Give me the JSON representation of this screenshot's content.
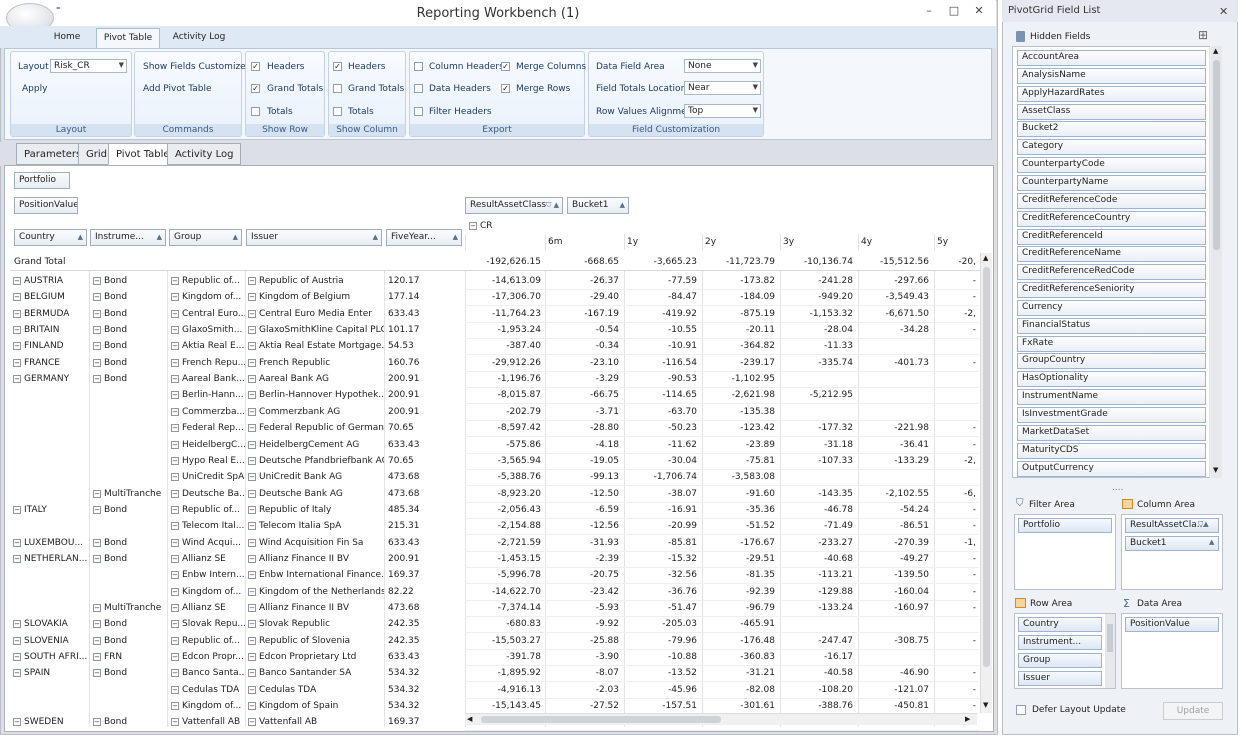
{
  "window": {
    "title": "Reporting Workbench (1)",
    "quick_access": "⁼",
    "min": "–",
    "max": "□",
    "close": "✕"
  },
  "ribbon_tabs": [
    "Home",
    "Pivot Table",
    "Activity Log"
  ],
  "ribbon": {
    "layout_group": {
      "layout_label": "Layout",
      "layout_value": "Risk_CR",
      "apply": "Apply",
      "caption": "Layout"
    },
    "commands_group": {
      "show_fields": "Show Fields Customizer",
      "add_pivot": "Add Pivot Table",
      "caption": "Commands"
    },
    "show_row": {
      "items": [
        {
          "label": "Headers",
          "checked": true
        },
        {
          "label": "Grand Totals",
          "checked": true
        },
        {
          "label": "Totals",
          "checked": false
        }
      ],
      "caption": "Show Row"
    },
    "show_column": {
      "items": [
        {
          "label": "Headers",
          "checked": true
        },
        {
          "label": "Grand Totals",
          "checked": false
        },
        {
          "label": "Totals",
          "checked": false
        }
      ],
      "caption": "Show Column"
    },
    "export": {
      "col1": [
        {
          "label": "Column Headers",
          "checked": false
        },
        {
          "label": "Data Headers",
          "checked": false
        },
        {
          "label": "Filter Headers",
          "checked": false
        }
      ],
      "col2": [
        {
          "label": "Merge Columns",
          "checked": true
        },
        {
          "label": "Merge Rows",
          "checked": true
        }
      ],
      "caption": "Export"
    },
    "field_custom": {
      "items": [
        {
          "label": "Data Field Area",
          "value": "None"
        },
        {
          "label": "Field Totals Location",
          "value": "Near"
        },
        {
          "label": "Row Values Alignment",
          "value": "Top"
        }
      ],
      "caption": "Field Customization"
    }
  },
  "doc_tabs": [
    "Parameters",
    "Grid",
    "Pivot Table",
    "Activity Log"
  ],
  "pivot": {
    "filter_field": "Portfolio",
    "data_field": "PositionValue",
    "col_fields": [
      "ResultAssetClass",
      "Bucket1"
    ],
    "row_fields": [
      "Country",
      "Instrume...",
      "Group",
      "Issuer",
      "FiveYear..."
    ],
    "cr_label": "CR",
    "col_buckets": [
      "",
      "6m",
      "1y",
      "2y",
      "3y",
      "4y",
      "5y"
    ],
    "grand_total_label": "Grand Total",
    "grand_total_values": [
      "-192,626.15",
      "-668.65",
      "-3,665.23",
      "-11,723.79",
      "-10,136.74",
      "-15,512.56",
      "-20,"
    ],
    "rows": [
      {
        "country": "AUSTRIA",
        "instr": "Bond",
        "group": "Republic of...",
        "issuer": "Republic of Austria",
        "five": "120.17",
        "v": [
          "-14,613.09",
          "-26.37",
          "-77.59",
          "-173.82",
          "-241.28",
          "-297.66",
          "-"
        ]
      },
      {
        "country": "BELGIUM",
        "instr": "Bond",
        "group": "Kingdom of...",
        "issuer": "Kingdom of Belgium",
        "five": "177.14",
        "v": [
          "-17,306.70",
          "-29.40",
          "-84.47",
          "-184.09",
          "-949.20",
          "-3,549.43",
          "-"
        ]
      },
      {
        "country": "BERMUDA",
        "instr": "Bond",
        "group": "Central Euro...",
        "issuer": "Central Euro Media Enter",
        "five": "633.43",
        "v": [
          "-11,764.23",
          "-167.19",
          "-419.92",
          "-875.19",
          "-1,153.32",
          "-6,671.50",
          "-2,"
        ]
      },
      {
        "country": "BRITAIN",
        "instr": "Bond",
        "group": "GlaxoSmith...",
        "issuer": "GlaxoSmithKline Capital PLC",
        "five": "101.17",
        "v": [
          "-1,953.24",
          "-0.54",
          "-10.55",
          "-20.11",
          "-28.04",
          "-34.28",
          "-"
        ]
      },
      {
        "country": "FINLAND",
        "instr": "Bond",
        "group": "Aktia Real E...",
        "issuer": "Aktia Real Estate Mortgage...",
        "five": "54.53",
        "v": [
          "-387.40",
          "-0.34",
          "-10.91",
          "-364.82",
          "-11.33",
          "",
          ""
        ]
      },
      {
        "country": "FRANCE",
        "instr": "Bond",
        "group": "French Repu...",
        "issuer": "French Republic",
        "five": "160.76",
        "v": [
          "-29,912.26",
          "-23.10",
          "-116.54",
          "-239.17",
          "-335.74",
          "-401.73",
          "-"
        ]
      },
      {
        "country": "GERMANY",
        "instr": "Bond",
        "group": "Aareal Bank...",
        "issuer": "Aareal Bank AG",
        "five": "200.91",
        "v": [
          "-1,196.76",
          "-3.29",
          "-90.53",
          "-1,102.95",
          "",
          "",
          ""
        ]
      },
      {
        "country": "",
        "instr": "",
        "group": "Berlin-Hann...",
        "issuer": "Berlin-Hannover Hypothek...",
        "five": "200.91",
        "v": [
          "-8,015.87",
          "-66.75",
          "-114.65",
          "-2,621.98",
          "-5,212.95",
          "",
          ""
        ]
      },
      {
        "country": "",
        "instr": "",
        "group": "Commerzba...",
        "issuer": "Commerzbank AG",
        "five": "200.91",
        "v": [
          "-202.79",
          "-3.71",
          "-63.70",
          "-135.38",
          "",
          "",
          ""
        ]
      },
      {
        "country": "",
        "instr": "",
        "group": "Federal Rep...",
        "issuer": "Federal Republic of Germany",
        "five": "70.65",
        "v": [
          "-8,597.42",
          "-28.80",
          "-50.23",
          "-123.42",
          "-177.32",
          "-221.98",
          "-"
        ]
      },
      {
        "country": "",
        "instr": "",
        "group": "HeidelbergC...",
        "issuer": "HeidelbergCement AG",
        "five": "633.43",
        "v": [
          "-575.86",
          "-4.18",
          "-11.62",
          "-23.89",
          "-31.18",
          "-36.41",
          "-"
        ]
      },
      {
        "country": "",
        "instr": "",
        "group": "Hypo Real E...",
        "issuer": "Deutsche Pfandbriefbank AG",
        "five": "70.65",
        "v": [
          "-3,565.94",
          "-19.05",
          "-30.04",
          "-75.81",
          "-107.33",
          "-133.29",
          "-2,"
        ]
      },
      {
        "country": "",
        "instr": "",
        "group": "UniCredit SpA",
        "issuer": "UniCredit Bank AG",
        "five": "473.68",
        "v": [
          "-5,388.76",
          "-99.13",
          "-1,706.74",
          "-3,583.08",
          "",
          "",
          ""
        ]
      },
      {
        "country": "",
        "instr": "MultiTranche",
        "group": "Deutsche Ba...",
        "issuer": "Deutsche Bank AG",
        "five": "473.68",
        "v": [
          "-8,923.20",
          "-12.50",
          "-38.07",
          "-91.60",
          "-143.35",
          "-2,102.55",
          "-6,"
        ]
      },
      {
        "country": "ITALY",
        "instr": "Bond",
        "group": "Republic of...",
        "issuer": "Republic of Italy",
        "five": "485.34",
        "v": [
          "-2,056.43",
          "-6.59",
          "-16.91",
          "-35.36",
          "-46.78",
          "-54.24",
          "-"
        ]
      },
      {
        "country": "",
        "instr": "",
        "group": "Telecom Ital...",
        "issuer": "Telecom Italia SpA",
        "five": "215.31",
        "v": [
          "-2,154.88",
          "-12.56",
          "-20.99",
          "-51.52",
          "-71.49",
          "-86.51",
          "-"
        ]
      },
      {
        "country": "LUXEMBOU...",
        "instr": "Bond",
        "group": "Wind Acqui...",
        "issuer": "Wind Acquisition Fin Sa",
        "five": "633.43",
        "v": [
          "-2,721.59",
          "-31.93",
          "-85.81",
          "-176.67",
          "-233.27",
          "-270.39",
          "-1,"
        ]
      },
      {
        "country": "NETHERLAN...",
        "instr": "Bond",
        "group": "Allianz SE",
        "issuer": "Allianz Finance II BV",
        "five": "200.91",
        "v": [
          "-1,453.15",
          "-2.39",
          "-15.32",
          "-29.51",
          "-40.68",
          "-49.27",
          "-"
        ]
      },
      {
        "country": "",
        "instr": "",
        "group": "Enbw Intern...",
        "issuer": "Enbw International Finance...",
        "five": "169.37",
        "v": [
          "-5,996.78",
          "-20.75",
          "-32.56",
          "-81.35",
          "-113.21",
          "-139.50",
          "-"
        ]
      },
      {
        "country": "",
        "instr": "",
        "group": "Kingdom of...",
        "issuer": "Kingdom of the Netherlands",
        "five": "82.22",
        "v": [
          "-14,622.70",
          "-23.42",
          "-36.76",
          "-92.39",
          "-129.88",
          "-160.04",
          "-"
        ]
      },
      {
        "country": "",
        "instr": "MultiTranche",
        "group": "Allianz SE",
        "issuer": "Allianz Finance II BV",
        "five": "473.68",
        "v": [
          "-7,374.14",
          "-5.93",
          "-51.47",
          "-96.79",
          "-133.24",
          "-160.97",
          "-"
        ]
      },
      {
        "country": "SLOVAKIA",
        "instr": "Bond",
        "group": "Slovak Repu...",
        "issuer": "Slovak Republic",
        "five": "242.35",
        "v": [
          "-680.83",
          "-9.92",
          "-205.03",
          "-465.91",
          "",
          "",
          ""
        ]
      },
      {
        "country": "SLOVENIA",
        "instr": "Bond",
        "group": "Republic of...",
        "issuer": "Republic of Slovenia",
        "five": "242.35",
        "v": [
          "-15,503.27",
          "-25.88",
          "-79.96",
          "-176.48",
          "-247.47",
          "-308.75",
          "-"
        ]
      },
      {
        "country": "SOUTH AFRI...",
        "instr": "FRN",
        "group": "Edcon Propr...",
        "issuer": "Edcon Proprietary Ltd",
        "five": "633.43",
        "v": [
          "-391.78",
          "-3.90",
          "-10.88",
          "-360.83",
          "-16.17",
          "",
          ""
        ]
      },
      {
        "country": "SPAIN",
        "instr": "Bond",
        "group": "Banco Santa...",
        "issuer": "Banco Santander SA",
        "five": "534.32",
        "v": [
          "-1,895.92",
          "-8.07",
          "-13.52",
          "-31.21",
          "-40.58",
          "-46.90",
          "-"
        ]
      },
      {
        "country": "",
        "instr": "",
        "group": "Cedulas TDA",
        "issuer": "Cedulas TDA",
        "five": "534.32",
        "v": [
          "-4,916.13",
          "-2.03",
          "-45.96",
          "-82.08",
          "-108.20",
          "-121.07",
          "-"
        ]
      },
      {
        "country": "",
        "instr": "",
        "group": "Kingdom of...",
        "issuer": "Kingdom of Spain",
        "five": "534.32",
        "v": [
          "-15,143.45",
          "-27.52",
          "-157.51",
          "-301.61",
          "-388.76",
          "-450.81",
          "-"
        ]
      },
      {
        "country": "SWEDEN",
        "instr": "Bond",
        "group": "Vattenfall AB",
        "issuer": "Vattenfall AB",
        "five": "169.37",
        "v": [
          "",
          "",
          "",
          "",
          "",
          "",
          ""
        ]
      }
    ]
  },
  "field_list": {
    "title": "PivotGrid Field List",
    "hidden_fields_label": "Hidden Fields",
    "hidden_fields": [
      "AccountArea",
      "AnalysisName",
      "ApplyHazardRates",
      "AssetClass",
      "Bucket2",
      "Category",
      "CounterpartyCode",
      "CounterpartyName",
      "CreditReferenceCode",
      "CreditReferenceCountry",
      "CreditReferenceId",
      "CreditReferenceName",
      "CreditReferenceRedCode",
      "CreditReferenceSeniority",
      "Currency",
      "FinancialStatus",
      "FxRate",
      "GroupCountry",
      "HasOptionality",
      "InstrumentName",
      "IsInvestmentGrade",
      "MarketDataSet",
      "MaturityCDS",
      "OutputCurrency"
    ],
    "filter_area_label": "Filter Area",
    "filter_items": [
      "Portfolio"
    ],
    "column_area_label": "Column Area",
    "column_items": [
      "ResultAssetCla...",
      "Bucket1"
    ],
    "row_area_label": "Row Area",
    "row_items": [
      "Country",
      "Instrument...",
      "Group",
      "Issuer"
    ],
    "data_area_label": "Data Area",
    "data_items": [
      "PositionValue"
    ],
    "defer_label": "Defer Layout Update",
    "update_label": "Update"
  }
}
